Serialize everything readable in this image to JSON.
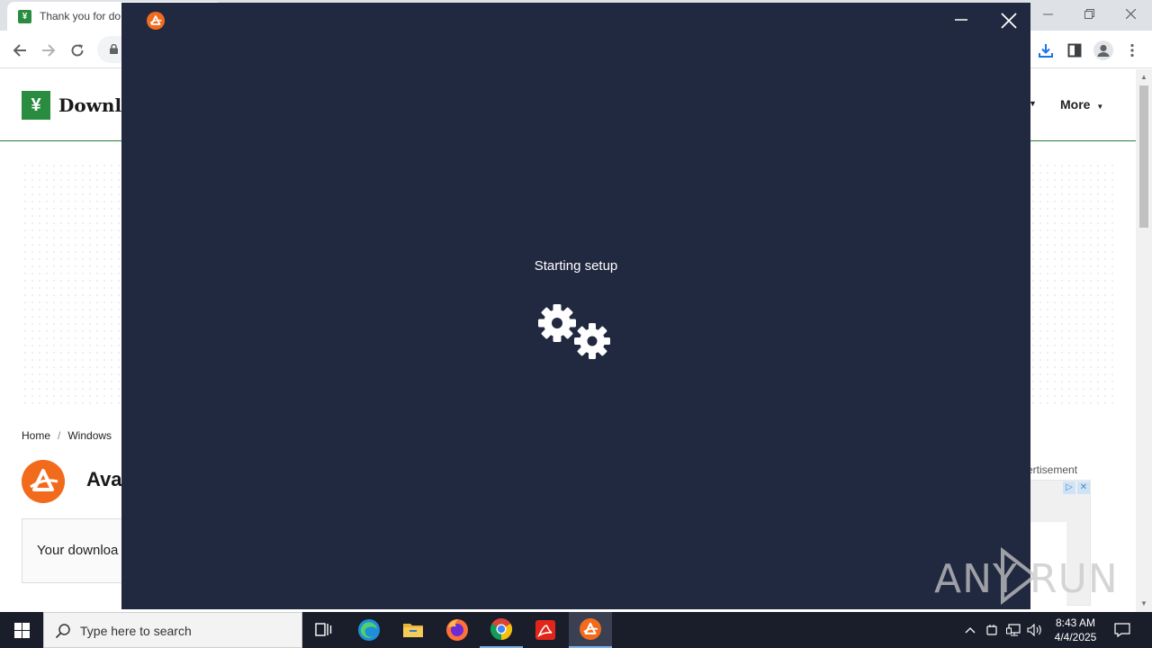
{
  "browser": {
    "tab_title": "Thank you for do",
    "tab_favicon_glyph": "¥"
  },
  "page": {
    "site_name": "Downlo",
    "nav_more": "More",
    "breadcrumb": [
      "Home",
      "Windows"
    ],
    "product_name": "Ava",
    "download_text": "Your downloa",
    "ad_label": "ertisement"
  },
  "installer": {
    "status": "Starting setup",
    "accent_color": "#f26b1d",
    "background_color": "#212940"
  },
  "watermark": {
    "left": "ANY",
    "right": "RUN"
  },
  "taskbar": {
    "search_placeholder": "Type here to search",
    "time": "8:43 AM",
    "date": "4/4/2025"
  }
}
